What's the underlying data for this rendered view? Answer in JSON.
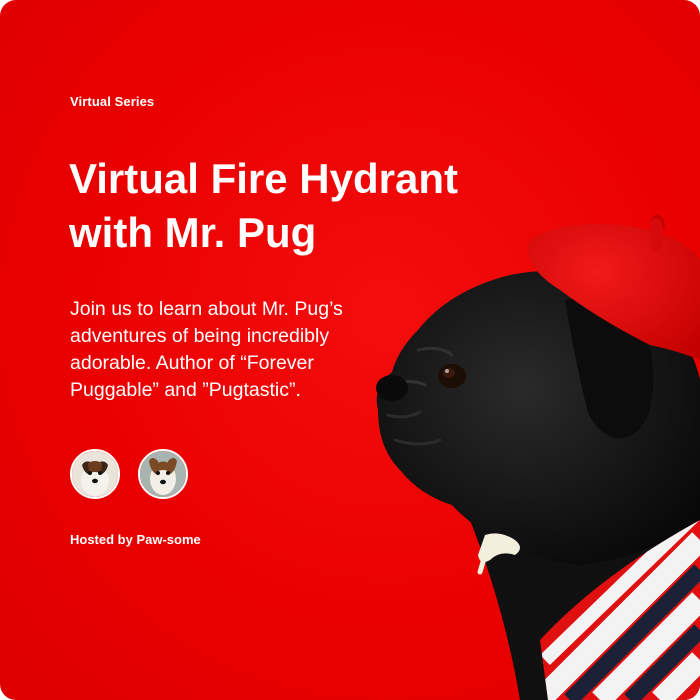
{
  "event": {
    "series_label": "Virtual Series",
    "title": "Virtual Fire Hydrant with Mr. Pug",
    "description": "Join us to learn about Mr. Pug’s adventures of being incredibly adorable. Author of “Forever Puggable” and  ”Pugtastic”.",
    "hosted_by": "Hosted by Paw-some"
  },
  "avatars": [
    {
      "name": "host-dog-1"
    },
    {
      "name": "host-dog-2"
    }
  ],
  "colors": {
    "background": "#ea0000",
    "text": "#ffffff",
    "beret": "#e00808",
    "pug": "#141414"
  }
}
